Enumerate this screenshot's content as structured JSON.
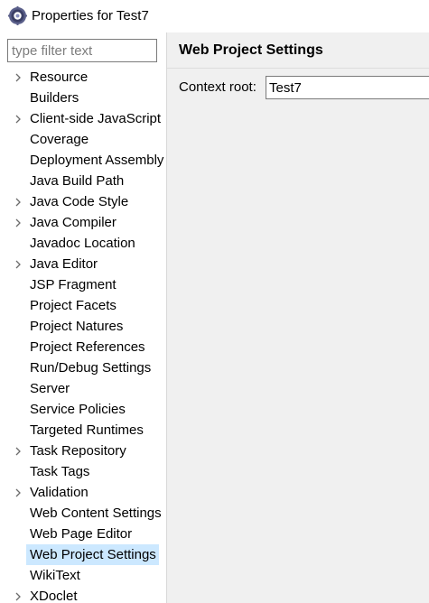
{
  "window": {
    "title": "Properties for Test7",
    "icon": "gear-cog-icon"
  },
  "filter": {
    "placeholder": "type filter text",
    "value": ""
  },
  "tree": {
    "items": [
      {
        "label": "Resource",
        "expandable": true
      },
      {
        "label": "Builders",
        "expandable": false
      },
      {
        "label": "Client-side JavaScript",
        "expandable": true
      },
      {
        "label": "Coverage",
        "expandable": false
      },
      {
        "label": "Deployment Assembly",
        "expandable": false
      },
      {
        "label": "Java Build Path",
        "expandable": false
      },
      {
        "label": "Java Code Style",
        "expandable": true
      },
      {
        "label": "Java Compiler",
        "expandable": true
      },
      {
        "label": "Javadoc Location",
        "expandable": false
      },
      {
        "label": "Java Editor",
        "expandable": true
      },
      {
        "label": "JSP Fragment",
        "expandable": false
      },
      {
        "label": "Project Facets",
        "expandable": false
      },
      {
        "label": "Project Natures",
        "expandable": false
      },
      {
        "label": "Project References",
        "expandable": false
      },
      {
        "label": "Run/Debug Settings",
        "expandable": false
      },
      {
        "label": "Server",
        "expandable": false
      },
      {
        "label": "Service Policies",
        "expandable": false
      },
      {
        "label": "Targeted Runtimes",
        "expandable": false
      },
      {
        "label": "Task Repository",
        "expandable": true
      },
      {
        "label": "Task Tags",
        "expandable": false
      },
      {
        "label": "Validation",
        "expandable": true
      },
      {
        "label": "Web Content Settings",
        "expandable": false
      },
      {
        "label": "Web Page Editor",
        "expandable": false
      },
      {
        "label": "Web Project Settings",
        "expandable": false,
        "selected": true
      },
      {
        "label": "WikiText",
        "expandable": false
      },
      {
        "label": "XDoclet",
        "expandable": true
      }
    ]
  },
  "page": {
    "title": "Web Project Settings",
    "context_root_label": "Context root:",
    "context_root_value": "Test7"
  },
  "colors": {
    "selection": "#cce8ff",
    "page_background": "#f0f0f0"
  }
}
